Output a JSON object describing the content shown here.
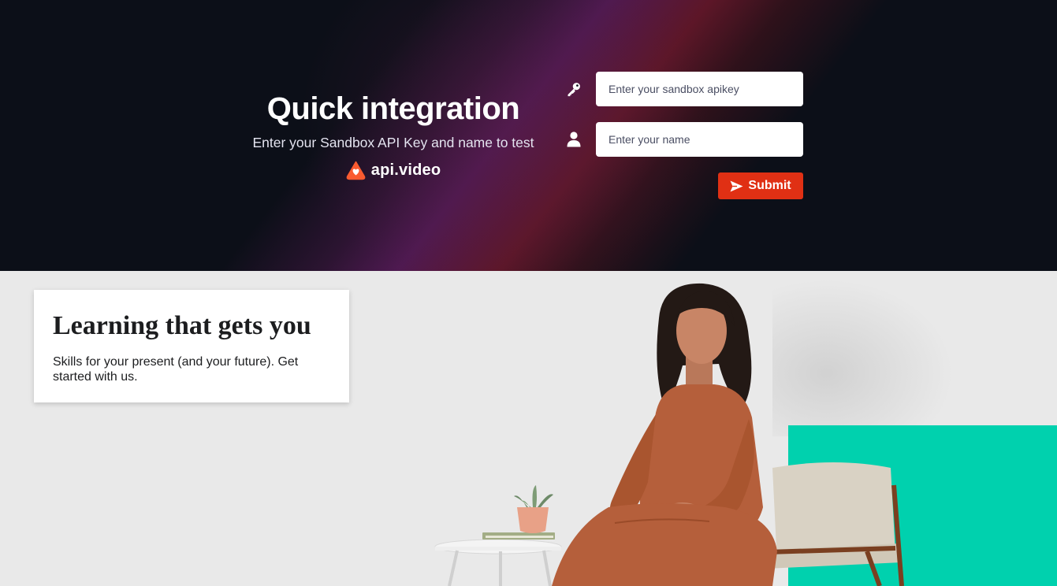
{
  "hero": {
    "title": "Quick integration",
    "subtitle": "Enter your Sandbox API Key and name to test",
    "brand_name": "api.video",
    "brand_color": "#fa5b30"
  },
  "form": {
    "apikey_placeholder": "Enter your sandbox apikey",
    "name_placeholder": "Enter your name",
    "apikey_icon": "key-icon",
    "name_icon": "user-icon",
    "submit_label": "Submit",
    "submit_icon": "send-icon",
    "submit_color": "#e03014"
  },
  "banner": {
    "title": "Learning that gets you",
    "text": "Skills for your present (and your future). Get started with us.",
    "accent_color": "#00d1ae"
  }
}
